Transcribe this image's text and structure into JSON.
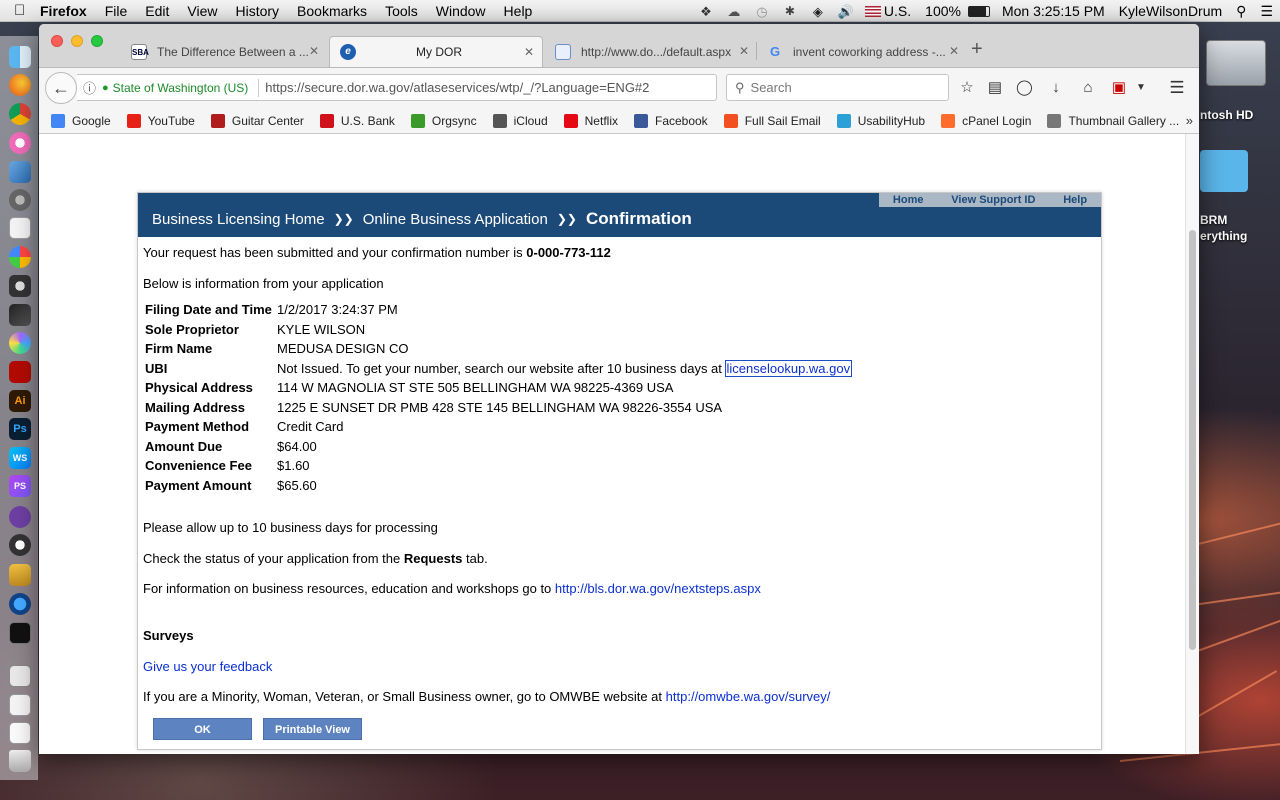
{
  "menubar": {
    "app": "Firefox",
    "items": [
      "File",
      "Edit",
      "View",
      "History",
      "Bookmarks",
      "Tools",
      "Window",
      "Help"
    ],
    "input_source": "U.S.",
    "battery": "100%",
    "clock": "Mon 3:25:15 PM",
    "user": "KyleWilsonDrum"
  },
  "desktop": {
    "hd_label": "ntosh HD",
    "folder_label_1": "BRM",
    "folder_label_2": "erything"
  },
  "tabs": [
    {
      "title": "The Difference Between a ...",
      "icon": "sba-icon"
    },
    {
      "title": "My DOR",
      "icon": "dor-icon"
    },
    {
      "title": "http://www.do.../default.aspx",
      "icon": "page-icon"
    },
    {
      "title": "invent coworking address -...",
      "icon": "google-icon"
    }
  ],
  "urlbar": {
    "org": "State of Washington (US)",
    "url": "https://secure.dor.wa.gov/atlaseservices/wtp/_/?Language=ENG#2"
  },
  "search": {
    "placeholder": "Search"
  },
  "bookmarks": [
    {
      "label": "Google",
      "color": "#4285f4"
    },
    {
      "label": "YouTube",
      "color": "#e62117"
    },
    {
      "label": "Guitar Center",
      "color": "#b01c1c"
    },
    {
      "label": "U.S. Bank",
      "color": "#d0101a"
    },
    {
      "label": "Orgsync",
      "color": "#3a9a2a"
    },
    {
      "label": "iCloud",
      "color": "#555555"
    },
    {
      "label": "Netflix",
      "color": "#e50914"
    },
    {
      "label": "Facebook",
      "color": "#3b5998"
    },
    {
      "label": "Full Sail Email",
      "color": "#f25022"
    },
    {
      "label": "UsabilityHub",
      "color": "#2aa0d6"
    },
    {
      "label": "cPanel Login",
      "color": "#ff6c2c"
    },
    {
      "label": "Thumbnail Gallery ...",
      "color": "#777777"
    }
  ],
  "dor": {
    "breadcrumb_home": "Business Licensing Home",
    "breadcrumb_app": "Online Business Application",
    "breadcrumb_current": "Confirmation",
    "toplinks": [
      "Home",
      "View Support ID",
      "Help"
    ],
    "intro_text": "Your request has been submitted and your confirmation number is",
    "confirmation_number": "0-000-773-112",
    "below_text": "Below is information from your application",
    "fields": [
      {
        "label": "Filing Date and Time",
        "value": "1/2/2017 3:24:37 PM"
      },
      {
        "label": "Sole Proprietor",
        "value": "KYLE WILSON"
      },
      {
        "label": "Firm Name",
        "value": "MEDUSA DESIGN CO"
      },
      {
        "label": "UBI",
        "value": "Not Issued. To get your number, search our website after 10 business days at",
        "link": "licenselookup.wa.gov"
      },
      {
        "label": "Physical Address",
        "value": "114 W MAGNOLIA ST STE 505 BELLINGHAM WA 98225-4369 USA"
      },
      {
        "label": "Mailing Address",
        "value": "1225 E SUNSET DR PMB 428 STE 145 BELLINGHAM WA 98226-3554 USA"
      },
      {
        "label": "Payment Method",
        "value": "Credit Card"
      },
      {
        "label": "Amount Due",
        "value": "$64.00"
      },
      {
        "label": "Convenience Fee",
        "value": "$1.60"
      },
      {
        "label": "Payment Amount",
        "value": "$65.60"
      }
    ],
    "processing_text": "Please allow up to 10 business days for processing",
    "status_pre": "Check the status of your application from the",
    "status_bold": "Requests",
    "status_post": "tab.",
    "resources_text": "For information on business resources, education and workshops go to",
    "resources_link": "http://bls.dor.wa.gov/nextsteps.aspx",
    "surveys_heading": "Surveys",
    "feedback_link": "Give us your feedback",
    "omwbe_text": "If you are a Minority, Woman, Veteran, or Small Business owner, go to OMWBE website at",
    "omwbe_link": "http://omwbe.wa.gov/survey/",
    "ok_button": "OK",
    "printable_button": "Printable View"
  }
}
